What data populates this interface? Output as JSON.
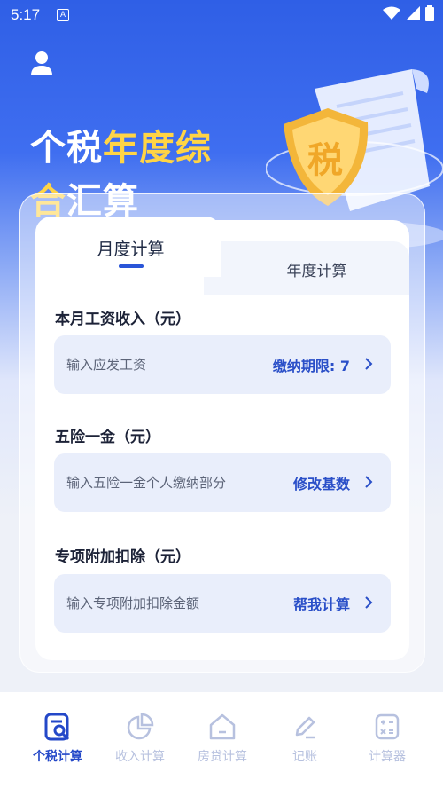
{
  "status_bar": {
    "time": "5:17",
    "notif": "A"
  },
  "hero": {
    "title_line1_plain": "个税",
    "title_line1_highlight": "年度综",
    "title_line2_highlight": "合",
    "title_line2_plain": "汇算",
    "emblem_char": "税"
  },
  "tabs": {
    "monthly": "月度计算",
    "annual": "年度计算",
    "active": "monthly"
  },
  "sections": [
    {
      "label": "本月工资收入（元）",
      "placeholder": "输入应发工资",
      "action": "缴纳期限: 7"
    },
    {
      "label": "五险一金（元）",
      "placeholder": "输入五险一金个人缴纳部分",
      "action": "修改基数"
    },
    {
      "label": "专项附加扣除（元）",
      "placeholder": "输入专项附加扣除金额",
      "action": "帮我计算"
    }
  ],
  "bottom_nav": [
    {
      "label": "个税计算",
      "icon": "tax-doc-icon",
      "active": true
    },
    {
      "label": "收入计算",
      "icon": "pie-chart-icon",
      "active": false
    },
    {
      "label": "房贷计算",
      "icon": "house-icon",
      "active": false
    },
    {
      "label": "记账",
      "icon": "pencil-icon",
      "active": false
    },
    {
      "label": "计算器",
      "icon": "calculator-icon",
      "active": false
    }
  ],
  "colors": {
    "accent": "#2448c8",
    "highlight": "#ffd445",
    "hero_blue": "#2f5fe6",
    "inactive_nav": "#b7c1df"
  }
}
